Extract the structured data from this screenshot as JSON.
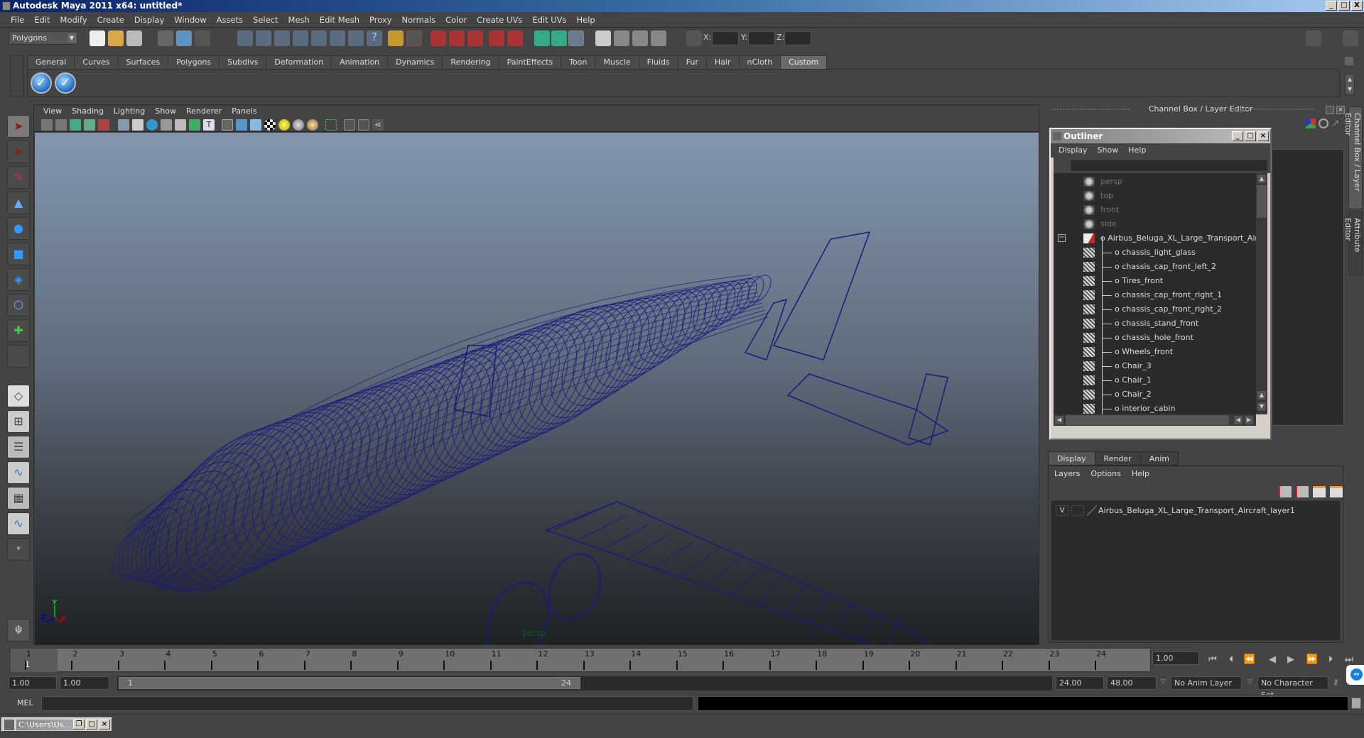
{
  "window": {
    "title": "Autodesk Maya 2011 x64: untitled*",
    "controls": [
      "_",
      "□",
      "X"
    ]
  },
  "menubar": [
    "File",
    "Edit",
    "Modify",
    "Create",
    "Display",
    "Window",
    "Assets",
    "Select",
    "Mesh",
    "Edit Mesh",
    "Proxy",
    "Normals",
    "Color",
    "Create UVs",
    "Edit UVs",
    "Help"
  ],
  "statusline": {
    "menu_set": "Polygons",
    "coord_labels": [
      "X:",
      "Y:",
      "Z:"
    ]
  },
  "shelf": {
    "tabs": [
      "General",
      "Curves",
      "Surfaces",
      "Polygons",
      "Subdivs",
      "Deformation",
      "Animation",
      "Dynamics",
      "Rendering",
      "PaintEffects",
      "Toon",
      "Muscle",
      "Fluids",
      "Fur",
      "Hair",
      "nCloth",
      "Custom"
    ],
    "active_tab": "Custom",
    "buttons": [
      "check-button-1",
      "check-button-2"
    ]
  },
  "toolbox": [
    "select-tool",
    "lasso-tool",
    "paint-select-tool",
    "move-tool",
    "rotate-tool",
    "scale-tool",
    "universal-manipulator",
    "soft-mod-tool",
    "show-manipulator",
    "last-used-tool"
  ],
  "viewport": {
    "menu": [
      "View",
      "Shading",
      "Lighting",
      "Show",
      "Renderer",
      "Panels"
    ],
    "camera": "persp",
    "axes": {
      "x": "X",
      "y": "Y",
      "z": "Z"
    },
    "model": "Airbus Beluga XL wireframe",
    "wire_color": "#1a1a7a"
  },
  "channel_box": {
    "title": "Channel Box / Layer Editor"
  },
  "outliner": {
    "title": "Outliner",
    "menu": [
      "Display",
      "Show",
      "Help"
    ],
    "items": [
      {
        "label": "persp",
        "type": "camera",
        "depth": 0
      },
      {
        "label": "top",
        "type": "camera",
        "depth": 0
      },
      {
        "label": "front",
        "type": "camera",
        "depth": 0
      },
      {
        "label": "side",
        "type": "camera",
        "depth": 0
      },
      {
        "label": "Airbus_Beluga_XL_Large_Transport_Aircraft",
        "type": "group",
        "depth": 0,
        "expanded": true
      },
      {
        "label": "chassis_light_glass",
        "type": "mesh",
        "depth": 1
      },
      {
        "label": "chassis_cap_front_left_2",
        "type": "mesh",
        "depth": 1
      },
      {
        "label": "Tires_front",
        "type": "mesh",
        "depth": 1
      },
      {
        "label": "chassis_cap_front_right_1",
        "type": "mesh",
        "depth": 1
      },
      {
        "label": "chassis_cap_front_right_2",
        "type": "mesh",
        "depth": 1
      },
      {
        "label": "chassis_stand_front",
        "type": "mesh",
        "depth": 1
      },
      {
        "label": "chassis_hole_front",
        "type": "mesh",
        "depth": 1
      },
      {
        "label": "Wheels_front",
        "type": "mesh",
        "depth": 1
      },
      {
        "label": "Chair_3",
        "type": "mesh",
        "depth": 1
      },
      {
        "label": "Chair_1",
        "type": "mesh",
        "depth": 1
      },
      {
        "label": "Chair_2",
        "type": "mesh",
        "depth": 1
      },
      {
        "label": "interior_cabin",
        "type": "mesh",
        "depth": 1
      }
    ]
  },
  "layer_editor": {
    "tabs": [
      "Display",
      "Render",
      "Anim"
    ],
    "active_tab": "Display",
    "menu": [
      "Layers",
      "Options",
      "Help"
    ],
    "layers": [
      {
        "visible": "V",
        "name": "Airbus_Beluga_XL_Large_Transport_Aircraft_layer1"
      }
    ]
  },
  "side_tabs": [
    "Channel Box / Layer Editor",
    "Attribute Editor"
  ],
  "timeline": {
    "ticks": [
      "1",
      "2",
      "3",
      "4",
      "5",
      "6",
      "7",
      "8",
      "9",
      "10",
      "11",
      "12",
      "13",
      "14",
      "15",
      "16",
      "17",
      "18",
      "19",
      "20",
      "21",
      "22",
      "23",
      "24"
    ],
    "current_frame": "1",
    "current_time_field": "1.00"
  },
  "range": {
    "start": "1.00",
    "anim_start": "1.00",
    "range_start_label": "1",
    "range_end_label": "24",
    "end": "24.00",
    "anim_end": "48.00",
    "anim_layer": "No Anim Layer",
    "character_set": "No Character Set"
  },
  "command_line": {
    "label": "MEL",
    "value": ""
  },
  "minimized_window": {
    "title": "C:\\Users\\Us..."
  }
}
